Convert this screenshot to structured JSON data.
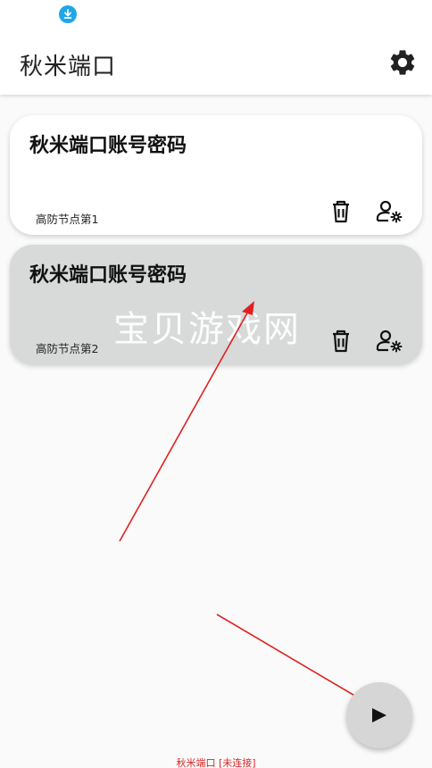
{
  "app": {
    "title": "秋米端口"
  },
  "accounts": [
    {
      "title": "秋米端口账号密码",
      "subtitle": "高防节点第1"
    },
    {
      "title": "秋米端口账号密码",
      "subtitle": "高防节点第2"
    }
  ],
  "watermark": "宝贝游戏网",
  "footer": {
    "status_text": "秋米端口 [未连接]"
  },
  "colors": {
    "selected_card": "#d8d9d9",
    "status_text": "#d8262a",
    "annotation_arrow": "#e02020",
    "download_badge": "#1ea7e8"
  },
  "icons": [
    "download-icon",
    "settings-gear-icon",
    "trash-icon",
    "user-settings-icon",
    "play-icon"
  ]
}
